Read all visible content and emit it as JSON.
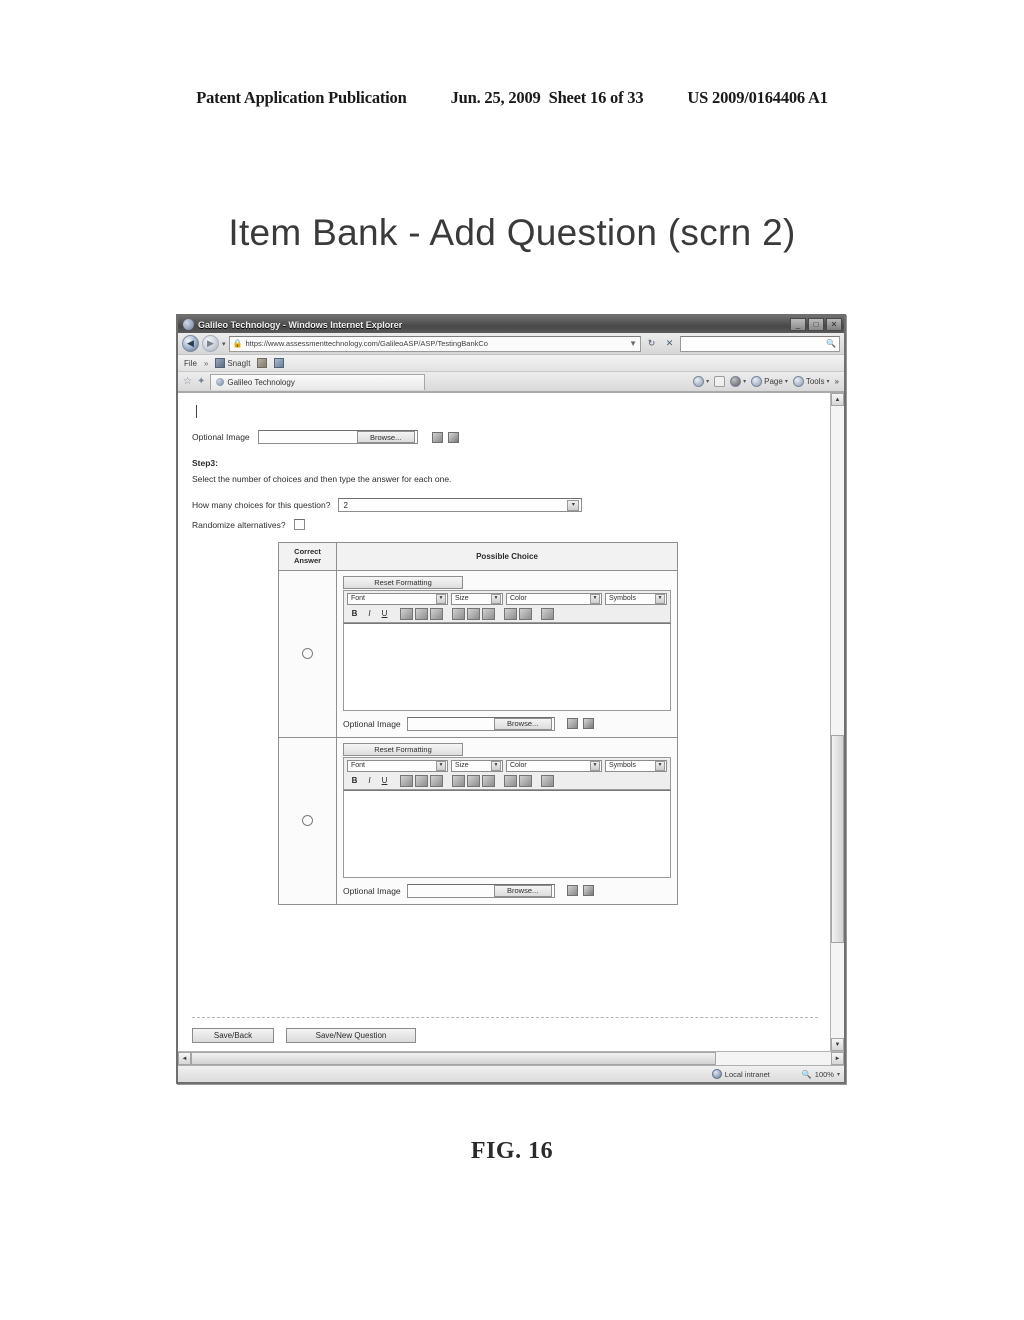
{
  "patent_header": {
    "publication": "Patent Application Publication",
    "date": "Jun. 25, 2009",
    "sheet": "Sheet 16 of 33",
    "number": "US 2009/0164406 A1"
  },
  "figure": {
    "title": "Item Bank - Add Question (scrn 2)",
    "caption": "FIG. 16"
  },
  "browser": {
    "window_title": "Galileo Technology - Windows Internet Explorer",
    "window_buttons": {
      "minimize": "_",
      "maximize": "□",
      "close": "✕"
    },
    "address": {
      "url": "https://www.assessmenttechnology.com/GalileoASP/ASP/TestingBankCo",
      "back_icon": "back-arrow-icon",
      "forward_icon": "forward-arrow-icon",
      "dropdown_icon": "▾",
      "lock_icon": "🔒",
      "refresh_icon": "↻",
      "stop_icon": "✕",
      "search_placeholder": "",
      "search_icon": "🔍"
    },
    "menu": {
      "file": "File",
      "overflow": "»",
      "snagit": "SnagIt"
    },
    "tab": {
      "label": "Galileo Technology",
      "favorites_icon": "star-icon",
      "add_favorites_icon": "add-favorites-icon"
    },
    "toolbar_right": {
      "home": "",
      "feeds": "",
      "print": "",
      "page": "Page",
      "tools": "Tools",
      "overflow": "»",
      "caret": "▾"
    },
    "status": {
      "zone": "Local intranet",
      "zoom": "100%",
      "caret": "▾"
    },
    "scroll": {
      "up": "▲",
      "down": "▼",
      "left": "◄",
      "right": "►"
    }
  },
  "page": {
    "optional_image_top": {
      "label": "Optional Image",
      "value": "",
      "browse_label": "Browse...",
      "icon_1": "upload-image-icon",
      "icon_2": "preview-image-icon"
    },
    "step": {
      "label": "Step3:",
      "description": "Select the number of choices and then type the answer for each one."
    },
    "choices_count": {
      "label": "How many choices for this question?",
      "value": "2",
      "arrow": "▾"
    },
    "randomize": {
      "label": "Randomize alternatives?",
      "checked": false
    },
    "table": {
      "headers": {
        "correct_answer": "Correct Answer",
        "possible_choice": "Possible Choice"
      },
      "rows": [
        {
          "selected": false,
          "editor": {
            "reset_label": "Reset Formatting",
            "font_label": "Font",
            "size_label": "Size",
            "color_label": "Color",
            "symbols_label": "Symbols",
            "buttons": [
              "B",
              "I",
              "U",
              "align-left-icon",
              "align-center-icon",
              "align-right-icon",
              "cut-icon",
              "copy-icon",
              "paste-icon",
              "outdent-icon",
              "indent-icon",
              "undo-icon"
            ],
            "content": ""
          },
          "optional_image": {
            "label": "Optional Image",
            "value": "",
            "browse_label": "Browse...",
            "icon_1": "upload-image-icon",
            "icon_2": "preview-image-icon"
          }
        },
        {
          "selected": false,
          "editor": {
            "reset_label": "Reset Formatting",
            "font_label": "Font",
            "size_label": "Size",
            "color_label": "Color",
            "symbols_label": "Symbols",
            "buttons": [
              "B",
              "I",
              "U",
              "align-left-icon",
              "align-center-icon",
              "align-right-icon",
              "cut-icon",
              "copy-icon",
              "paste-icon",
              "outdent-icon",
              "indent-icon",
              "undo-icon"
            ],
            "content": ""
          },
          "optional_image": {
            "label": "Optional Image",
            "value": "",
            "browse_label": "Browse...",
            "icon_1": "upload-image-icon",
            "icon_2": "preview-image-icon"
          }
        }
      ]
    },
    "actions": {
      "save_back": "Save/Back",
      "save_new_question": "Save/New Question"
    }
  }
}
